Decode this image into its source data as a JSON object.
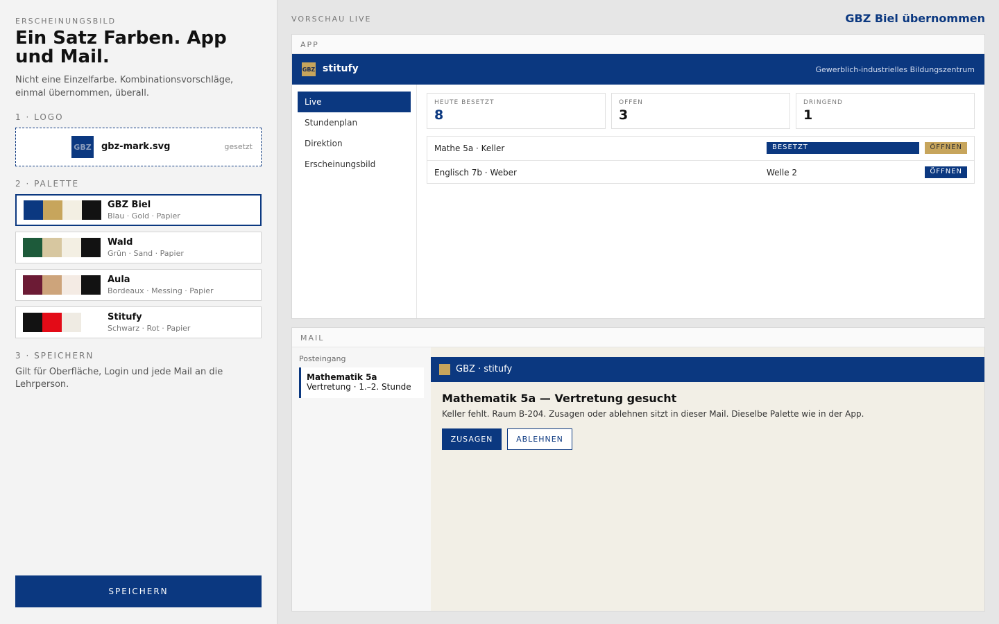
{
  "settings": {
    "eyebrow": "ERSCHEINUNGSBILD",
    "title": "Ein Satz Farben. App und Mail.",
    "subtitle": "Nicht eine Einzelfarbe. Kombinationsvorschläge, einmal übernommen, überall.",
    "step1": "1 · LOGO",
    "logo": {
      "mark_text": "GBZ",
      "file": "gbz-mark.svg",
      "status": "gesetzt"
    },
    "step2": "2 · PALETTE",
    "palettes": [
      {
        "name": "GBZ Biel",
        "sub": "Blau · Gold · Papier",
        "colors": [
          "#0b3880",
          "#c7a55c",
          "#f3efe3",
          "#121212"
        ],
        "selected": true
      },
      {
        "name": "Wald",
        "sub": "Grün · Sand · Papier",
        "colors": [
          "#1d5a3a",
          "#d7c7a0",
          "#f3efe3",
          "#121212"
        ],
        "selected": false
      },
      {
        "name": "Aula",
        "sub": "Bordeaux · Messing · Papier",
        "colors": [
          "#6c1b35",
          "#cda47b",
          "#f4ebe4",
          "#121212"
        ],
        "selected": false
      },
      {
        "name": "Stitufy",
        "sub": "Schwarz · Rot · Papier",
        "colors": [
          "#121212",
          "#e30b17",
          "#efebe3"
        ],
        "selected": false
      }
    ],
    "step3": "3 · SPEICHERN",
    "save_desc": "Gilt für Oberfläche, Login und jede Mail an die Lehrperson.",
    "save_label": "SPEICHERN"
  },
  "preview": {
    "label": "VORSCHAU LIVE",
    "applied": "GBZ Biel übernommen",
    "app": {
      "tag": "APP",
      "logo_text": "GBZ",
      "name": "stitufy",
      "org": "Gewerblich-industrielles Bildungszentrum",
      "nav": [
        "Live",
        "Stundenplan",
        "Direktion",
        "Erscheinungsbild"
      ],
      "stats": [
        {
          "label": "HEUTE BESETZT",
          "value": "8",
          "color": "#0b3880"
        },
        {
          "label": "OFFEN",
          "value": "3",
          "color": "#111111"
        },
        {
          "label": "DRINGEND",
          "value": "1",
          "color": "#111111"
        }
      ],
      "rows": [
        {
          "title": "Mathe 5a · Keller",
          "status": "BESETZT",
          "action": "ÖFFNEN"
        },
        {
          "title": "Englisch 7b · Weber",
          "status": "Welle 2",
          "action": "ÖFFNEN"
        }
      ]
    },
    "mail": {
      "tag": "MAIL",
      "inbox_label": "Posteingang",
      "item_subject": "Mathematik 5a",
      "item_preview": "Vertretung · 1.–2. Stunde",
      "from": "GBZ · stitufy",
      "title": "Mathematik 5a — Vertretung gesucht",
      "body": "Keller fehlt. Raum B-204. Zusagen oder ablehnen sitzt in dieser Mail. Dieselbe Palette wie in der App.",
      "accept": "ZUSAGEN",
      "decline": "ABLEHNEN"
    }
  }
}
